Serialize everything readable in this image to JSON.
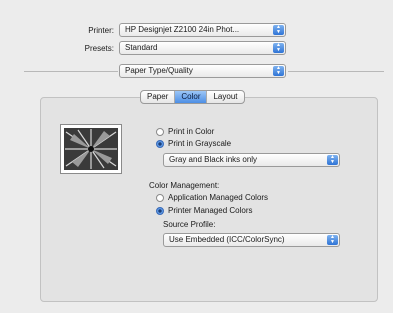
{
  "printer": {
    "label": "Printer:",
    "value": "HP Designjet Z2100 24in Phot..."
  },
  "presets": {
    "label": "Presets:",
    "value": "Standard"
  },
  "panel_menu": {
    "value": "Paper Type/Quality"
  },
  "tabs": [
    {
      "label": "Paper",
      "active": false
    },
    {
      "label": "Color",
      "active": true
    },
    {
      "label": "Layout",
      "active": false
    }
  ],
  "color_options": {
    "print_in_color": {
      "label": "Print in Color",
      "selected": false
    },
    "print_in_grayscale": {
      "label": "Print in Grayscale",
      "selected": true
    },
    "grayscale_mode": "Gray and Black inks only"
  },
  "color_management": {
    "title": "Color Management:",
    "application_managed": {
      "label": "Application Managed Colors",
      "selected": false
    },
    "printer_managed": {
      "label": "Printer Managed Colors",
      "selected": true
    },
    "source_profile_label": "Source Profile:",
    "source_profile_value": "Use Embedded (ICC/ColorSync)"
  },
  "icons": {
    "popup_arrows": "updown-arrows-icon",
    "preview": "grayscale-preview-image"
  }
}
